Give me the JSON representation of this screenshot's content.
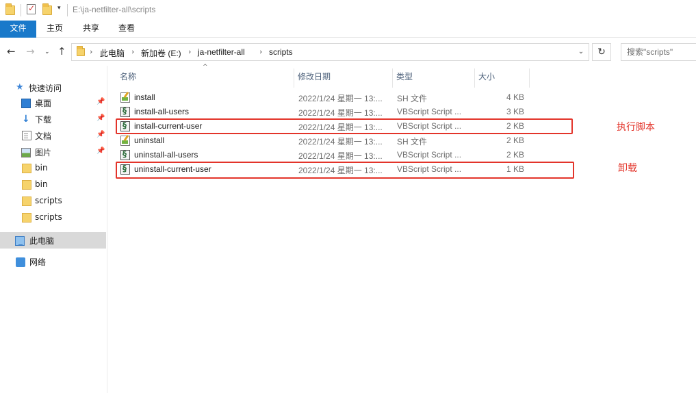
{
  "window": {
    "title_path": "E:\\ja-netfilter-all\\scripts",
    "icons": [
      "folder-icon",
      "properties-icon",
      "new-folder-icon"
    ],
    "quick_access_dropdown": "▾"
  },
  "ribbon": {
    "tabs": [
      {
        "label": "文件",
        "active": true
      },
      {
        "label": "主页"
      },
      {
        "label": "共享"
      },
      {
        "label": "查看"
      }
    ],
    "file_tab_color": "#1979ca"
  },
  "address": {
    "nav": {
      "back": "←",
      "forward": "→",
      "recent": "⌄",
      "up": "↑"
    },
    "crumbs": [
      "此电脑",
      "新加卷 (E:)",
      "ja-netfilter-all",
      "scripts"
    ],
    "separator": "›",
    "dropdown": "⌄",
    "refresh": "↻",
    "search_placeholder": "搜索\"scripts\""
  },
  "sidebar": {
    "items": [
      {
        "label": "快速访问",
        "icon": "star-icon",
        "pinned": false
      },
      {
        "label": "桌面",
        "icon": "desktop-icon",
        "pinned": true
      },
      {
        "label": "下载",
        "icon": "download-icon",
        "pinned": true
      },
      {
        "label": "文档",
        "icon": "document-icon",
        "pinned": true
      },
      {
        "label": "图片",
        "icon": "pictures-icon",
        "pinned": true
      },
      {
        "label": "bin",
        "icon": "folder-icon",
        "pinned": false
      },
      {
        "label": "bin",
        "icon": "folder-icon",
        "pinned": false
      },
      {
        "label": "scripts",
        "icon": "folder-icon",
        "pinned": false
      },
      {
        "label": "scripts",
        "icon": "folder-icon",
        "pinned": false
      },
      {
        "label": "此电脑",
        "icon": "pc-icon",
        "pinned": false,
        "selected": true
      },
      {
        "label": "网络",
        "icon": "network-icon",
        "pinned": false
      }
    ],
    "pin_glyph": "📌"
  },
  "files": {
    "columns": {
      "name": "名称",
      "date": "修改日期",
      "type": "类型",
      "size": "大小"
    },
    "sort_glyph": "^",
    "rows": [
      {
        "name": "install",
        "date": "2022/1/24 星期一 13:...",
        "type": "SH 文件",
        "size": "4 KB",
        "icon": "shell-script-icon"
      },
      {
        "name": "install-all-users",
        "date": "2022/1/24 星期一 13:...",
        "type": "VBScript Script ...",
        "size": "3 KB",
        "icon": "vbscript-icon"
      },
      {
        "name": "install-current-user",
        "date": "2022/1/24 星期一 13:...",
        "type": "VBScript Script ...",
        "size": "2 KB",
        "icon": "vbscript-icon"
      },
      {
        "name": "uninstall",
        "date": "2022/1/24 星期一 13:...",
        "type": "SH 文件",
        "size": "2 KB",
        "icon": "shell-script-icon"
      },
      {
        "name": "uninstall-all-users",
        "date": "2022/1/24 星期一 13:...",
        "type": "VBScript Script ...",
        "size": "2 KB",
        "icon": "vbscript-icon"
      },
      {
        "name": "uninstall-current-user",
        "date": "2022/1/24 星期一 13:...",
        "type": "VBScript Script ...",
        "size": "1 KB",
        "icon": "vbscript-icon"
      }
    ]
  },
  "annotations": {
    "color": "#e3342a",
    "notes": [
      "执行脚本",
      "卸载"
    ]
  }
}
